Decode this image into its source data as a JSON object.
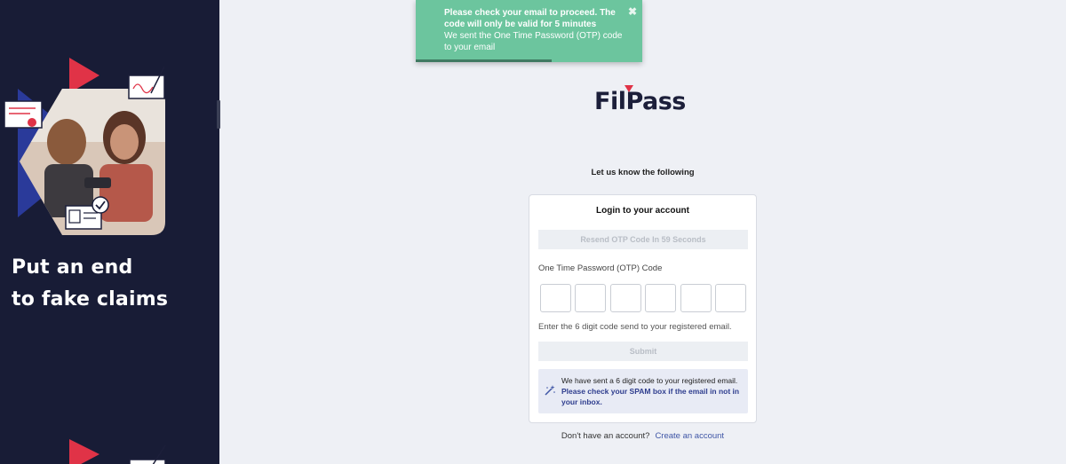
{
  "sidebar": {
    "tagline_line1": "Put an end",
    "tagline_line2": "to fake claims"
  },
  "toast": {
    "title": "Please check your email to proceed. The code will only be valid for 5 minutes",
    "message": "We sent the One Time Password (OTP) code to your email",
    "close_icon": "close-icon",
    "progress_fraction": 0.6
  },
  "brand": {
    "logo_text": "FilPass",
    "accent_color": "#e03347",
    "primary_color": "#1c1f3a"
  },
  "main": {
    "prompt": "Let us know the following",
    "card_title": "Login to your account",
    "resend_label": "Resend OTP Code In 59 Seconds",
    "otp_label": "One Time Password (OTP) Code",
    "otp_digits": [
      "",
      "",
      "",
      "",
      "",
      ""
    ],
    "hint": "Enter the 6 digit code send to your registered email.",
    "submit_label": "Submit",
    "notice_icon": "magic-wand-icon",
    "notice_text": "We have sent a 6 digit code to your registered email.",
    "notice_strong": "Please check your SPAM box if the email in not in your inbox."
  },
  "footer": {
    "question": "Don't have an account?",
    "create_link": "Create an account"
  },
  "colors": {
    "sidebar_bg": "#181c36",
    "toast_bg": "#6cc59e",
    "link": "#3f56a6"
  }
}
